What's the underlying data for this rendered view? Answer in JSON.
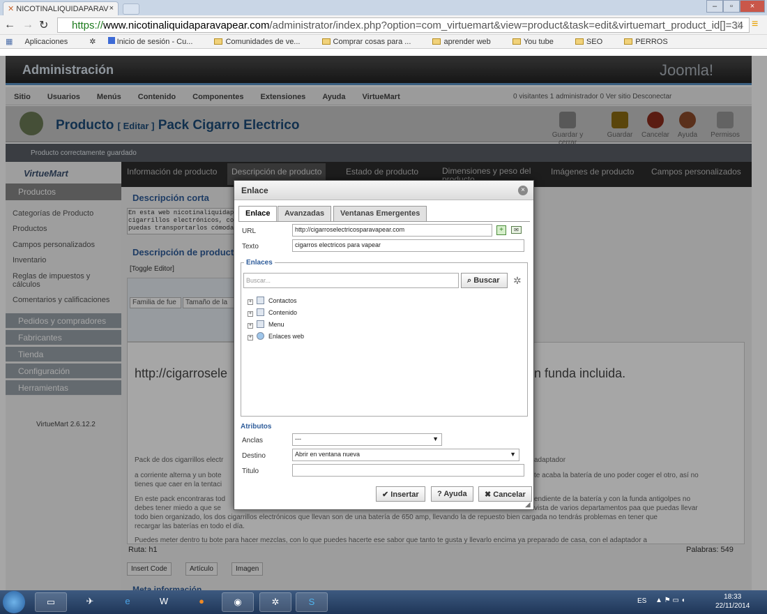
{
  "browser": {
    "tab_title": "NICOTINALIQUIDAPARAV",
    "url_scheme": "https://",
    "url_host": "www.nicotinaliquidaparavapear.com",
    "url_path": "/administrator/index.php?option=com_virtuemart&view=product&task=edit&virtuemart_product_id[]=34",
    "bookmarks": [
      "Aplicaciones",
      "Inicio de sesión - Cu...",
      "Comunidades de ve...",
      "Comprar cosas para ...",
      "aprender web",
      "You tube",
      "SEO",
      "PERROS"
    ]
  },
  "joomla": {
    "admin_title": "Administración",
    "logo": "Joomla!",
    "menu": [
      "Sitio",
      "Usuarios",
      "Menús",
      "Contenido",
      "Componentes",
      "Extensiones",
      "Ayuda",
      "VirtueMart"
    ],
    "status_right": "0 visitantes   1 administrador   0   Ver sitio   Desconectar",
    "page_title_main": "Producto",
    "page_title_edit": "[ Editar ]",
    "page_title_product": "Pack Cigarro Electrico",
    "toolbar": [
      "Guardar y cerrar",
      "Guardar",
      "Cancelar",
      "Ayuda",
      "Permisos"
    ],
    "message": "Producto correctamente guardado",
    "product_tabs": [
      "Información de producto",
      "Descripción de producto",
      "Estado de producto",
      "Dimensiones y peso del producto",
      "Imágenes de producto",
      "Campos personalizados"
    ]
  },
  "sidebar": {
    "logo": "VirtueMart",
    "products_header": "Productos",
    "links": [
      "Categorías de Producto",
      "Productos",
      "Campos personalizados",
      "Inventario",
      "Reglas de impuestos y cálculos",
      "Comentarios y calificaciones"
    ],
    "groups": [
      "Pedidos y compradores",
      "Fabricantes",
      "Tienda",
      "Configuración",
      "Herramientas"
    ],
    "version": "VirtueMart 2.6.12.2"
  },
  "content": {
    "short_desc_title": "Descripción corta",
    "short_desc_text": "En esta web nicotinaliquidap\ncigarrillos electrónicos, co\npuedas transportarlos cómoda",
    "desc_title": "Descripción de producto",
    "toggle_editor": "[Toggle Editor]",
    "font_family": "Familia de fue",
    "font_size": "Tamaño de la",
    "editor_big_left": "http://cigarrosele",
    "editor_big_right": "n funda incluida.",
    "para1": "Pack de dos cigarrillos electr",
    "para1_right": "adaptador",
    "para2": "a corriente alterna y un bote",
    "para2_right": "te acaba la batería de uno poder coger el otro, así no",
    "para2b": "tienes que caer en la tentaci",
    "para3": "En este pack encontraras tod",
    "para3_right": "endiente de la batería y con la funda antigolpes no",
    "para3b": "debes tener miedo a que se",
    "para3b_right": "vista de varios departamentos paa que puedas llevar",
    "para3c": "todo bien organizado, los dos cigarrillos electrónicos que llevan son de una batería de 650 amp, llevando la de repuesto bien cargada no tendrás problemas en tener que",
    "para3d": "recargar las baterías en todo el día.",
    "para4": "Puedes meter dentro tu bote para hacer mezclas, con lo que puedes hacerte ese sabor que tanto te gusta y llevarlo encima ya preparado de casa, con el adaptador a",
    "path": "Ruta: h1",
    "words": "Palabras: 549",
    "insert_buttons": [
      "Insert Code",
      "Artículo",
      "Imagen"
    ],
    "meta": "Meta información"
  },
  "modal": {
    "title": "Enlace",
    "tabs": [
      "Enlace",
      "Avanzadas",
      "Ventanas Emergentes"
    ],
    "url_label": "URL",
    "url_value": "http://cigarroselectricosparavapear.com",
    "text_label": "Texto",
    "text_value": "cigarros electricos para vapear",
    "links_legend": "Enlaces",
    "search_placeholder": "Buscar...",
    "search_button": "Buscar",
    "tree": [
      "Contactos",
      "Contenido",
      "Menu",
      "Enlaces web"
    ],
    "attributes_legend": "Atributos",
    "anchors_label": "Anclas",
    "anchors_value": "---",
    "target_label": "Destino",
    "target_value": "Abrir en ventana nueva",
    "title_label": "Titulo",
    "title_value": "",
    "insert_button": "Insertar",
    "help_button": "Ayuda",
    "cancel_button": "Cancelar"
  },
  "taskbar": {
    "lang": "ES",
    "time": "18:33",
    "date": "22/11/2014"
  }
}
